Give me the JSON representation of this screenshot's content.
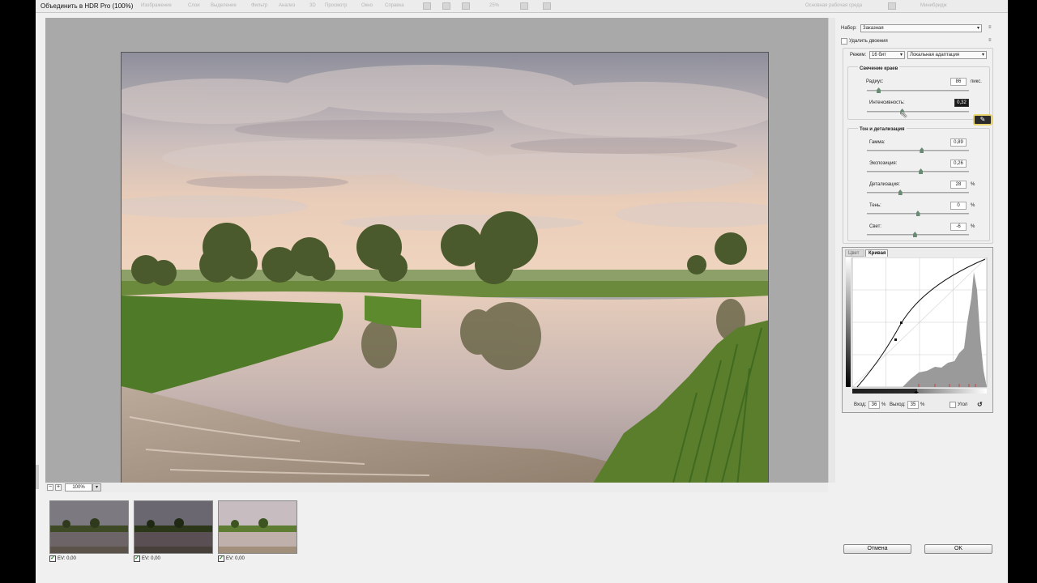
{
  "window": {
    "title": "Объединить в HDR Pro (100%)",
    "bg_menu": [
      "Изображение",
      "Слои",
      "Выделение",
      "Фильтр",
      "Анализ",
      "3D",
      "Просмотр",
      "Окно",
      "Справка"
    ],
    "bg_right": "Основная рабочая среда",
    "bg_search": "Минибридж",
    "bg_zoom": "25%"
  },
  "toolbar": {
    "zoom_value": "100%",
    "zoom_minus": "−",
    "zoom_plus": "+",
    "dropdown_arrow": "▾"
  },
  "filmstrip": [
    {
      "ev_label": "EV: 0,00",
      "checked": true
    },
    {
      "ev_label": "EV: 0,00",
      "checked": true
    },
    {
      "ev_label": "EV: 0,00",
      "checked": true
    }
  ],
  "panel": {
    "preset_label": "Набор:",
    "preset_value": "Заказная",
    "remove_ghosts_label": "Удалить двоения",
    "mode_label": "Режим:",
    "bit_depth": "16 бит",
    "method": "Локальная адаптация",
    "menu_icon": "≡",
    "dropdown_arrow": "▾",
    "edge_glow": {
      "heading": "Свечение краев",
      "radius_label": "Радиус:",
      "radius_value": "86",
      "radius_unit": "пикс.",
      "radius_level": 0.1,
      "strength_label": "Интенсивность:",
      "strength_value": "0,32",
      "strength_level": 0.34
    },
    "tone_detail": {
      "heading": "Тон и детализация",
      "gamma_label": "Гамма:",
      "gamma_value": "0,89",
      "gamma_level": 0.54,
      "exposure_label": "Экспозиция:",
      "exposure_value": "0,26",
      "exposure_level": 0.53,
      "detail_label": "Детализация:",
      "detail_value": "28",
      "detail_level": 0.32,
      "shadow_label": "Тень:",
      "shadow_value": "0",
      "shadow_level": 0.5,
      "highlight_label": "Свет:",
      "highlight_value": "-6",
      "highlight_level": 0.47,
      "percent": "%"
    },
    "tabs": {
      "color": "Цвет",
      "curve": "Кривая"
    },
    "curve": {
      "input_label": "Вход:",
      "input_value": "36",
      "percent": "%",
      "output_label": "Выход:",
      "output_value": "35",
      "corner_label": "Угол",
      "reset_icon": "↺"
    }
  },
  "buttons": {
    "cancel": "Отмена",
    "ok": "OK"
  },
  "tooltip": {
    "icon": "✎"
  },
  "cursor": "⇖"
}
